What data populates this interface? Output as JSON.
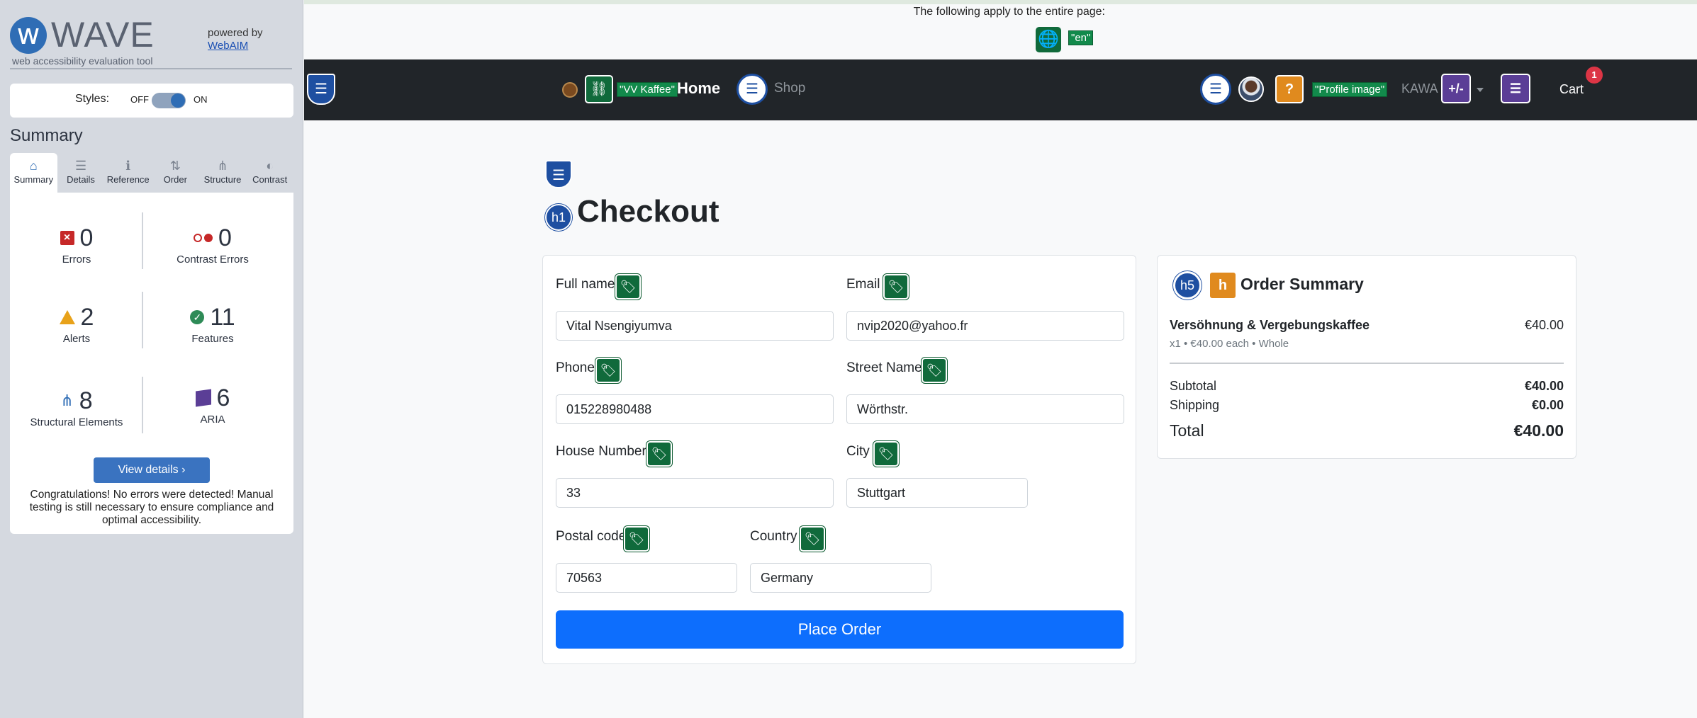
{
  "wave": {
    "logo_letter": "w",
    "logo_word": "WAVE",
    "tagline": "web accessibility evaluation tool",
    "powered_by": "powered by",
    "webaim": "WebAIM",
    "styles_label": "Styles:",
    "styles_off": "OFF",
    "styles_on": "ON",
    "summary_title": "Summary",
    "tabs": [
      {
        "label": "Summary",
        "icon": "⌂"
      },
      {
        "label": "Details",
        "icon": "☰"
      },
      {
        "label": "Reference",
        "icon": "ℹ"
      },
      {
        "label": "Order",
        "icon": "⇅"
      },
      {
        "label": "Structure",
        "icon": "⋔"
      },
      {
        "label": "Contrast",
        "icon": "◐"
      }
    ],
    "stats": {
      "errors": {
        "count": "0",
        "label": "Errors"
      },
      "contrast": {
        "count": "0",
        "label": "Contrast Errors"
      },
      "alerts": {
        "count": "2",
        "label": "Alerts"
      },
      "features": {
        "count": "11",
        "label": "Features"
      },
      "structural": {
        "count": "8",
        "label": "Structural Elements"
      },
      "aria": {
        "count": "6",
        "label": "ARIA"
      }
    },
    "view_details": "View details ›",
    "congrats": "Congratulations! No errors were detected! Manual testing is still necessary to ensure compliance and optimal accessibility."
  },
  "page_note": {
    "text": "The following apply to the entire page:",
    "lang": "\"en\""
  },
  "navbar": {
    "brand_label": "\"VV Kaffee\"",
    "home": "Home",
    "shop": "Shop",
    "profile_label": "\"Profile image\"",
    "user": "KAWA",
    "aria_toggle": "+/-",
    "cart": "Cart",
    "cart_count": "1"
  },
  "checkout": {
    "h1_tag": "h1",
    "title": "Checkout",
    "fields": {
      "full_name": {
        "label": "Full name",
        "value": "Vital Nsengiyumva"
      },
      "email": {
        "label": "Email",
        "value": "nvip2020@yahoo.fr"
      },
      "phone": {
        "label": "Phone",
        "value": "015228980488"
      },
      "street": {
        "label": "Street Name",
        "value": "Wörthstr."
      },
      "house": {
        "label": "House Number",
        "value": "33"
      },
      "city": {
        "label": "City",
        "value": "Stuttgart"
      },
      "postal": {
        "label": "Postal code",
        "value": "70563"
      },
      "country": {
        "label": "Country",
        "value": "Germany"
      }
    },
    "place_order": "Place Order"
  },
  "order_summary": {
    "h5_tag": "h5",
    "title": "Order Summary",
    "item_name": "Versöhnung & Vergebungskaffee",
    "item_price": "€40.00",
    "item_meta": "x1 • €40.00 each • Whole",
    "subtotal_label": "Subtotal",
    "subtotal": "€40.00",
    "shipping_label": "Shipping",
    "shipping": "€0.00",
    "total_label": "Total",
    "total": "€40.00"
  },
  "colors": {
    "wave_blue": "#2f6db5",
    "wave_green": "#106a3b",
    "navbar_bg": "#212529",
    "primary_button": "#0d6efd",
    "badge_red": "#dc3545"
  }
}
